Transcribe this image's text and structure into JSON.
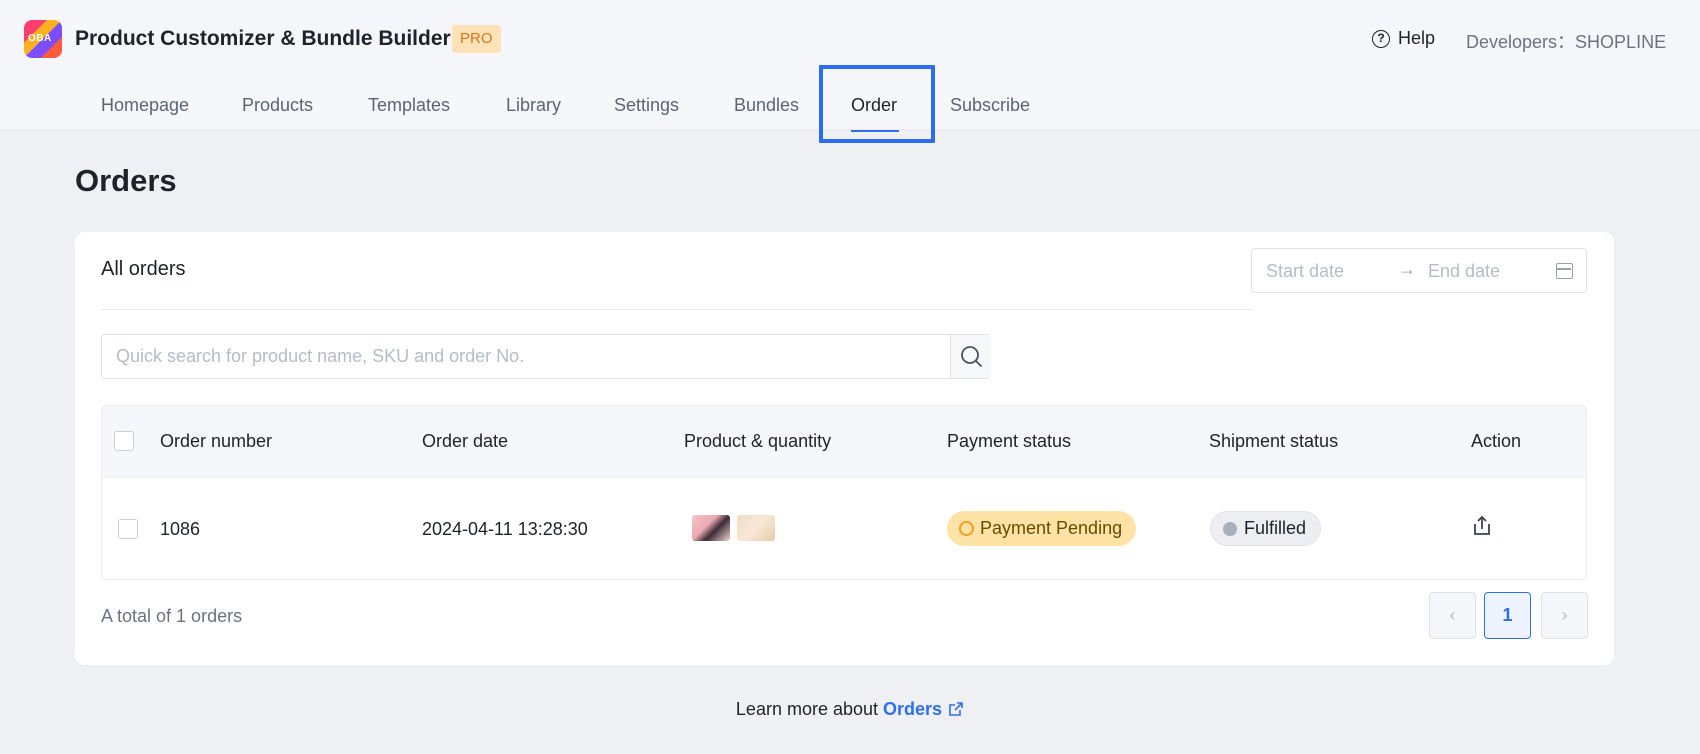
{
  "app": {
    "logo_text": "OBA",
    "title": "Product Customizer & Bundle Builder",
    "plan_badge": "PRO",
    "help_label": "Help",
    "developers_label": "Developers：SHOPLINE"
  },
  "nav": {
    "items": [
      {
        "label": "Homepage",
        "active": false
      },
      {
        "label": "Products",
        "active": false
      },
      {
        "label": "Templates",
        "active": false
      },
      {
        "label": "Library",
        "active": false
      },
      {
        "label": "Settings",
        "active": false
      },
      {
        "label": "Bundles",
        "active": false
      },
      {
        "label": "Order",
        "active": true
      },
      {
        "label": "Subscribe",
        "active": false
      }
    ]
  },
  "page": {
    "title": "Orders"
  },
  "orders_card": {
    "title": "All orders",
    "date_range": {
      "start_placeholder": "Start date",
      "arrow": "→",
      "end_placeholder": "End date"
    },
    "search": {
      "placeholder": "Quick search for product name, SKU and order No.",
      "value": ""
    },
    "table": {
      "columns": [
        "Order number",
        "Order date",
        "Product & quantity",
        "Payment status",
        "Shipment status",
        "Action"
      ],
      "rows": [
        {
          "order_number": "1086",
          "order_date": "2024-04-11 13:28:30",
          "product_thumbnails": 2,
          "payment_status": "Payment Pending",
          "shipment_status": "Fulfilled",
          "action_icon": "export-icon"
        }
      ]
    },
    "total_text": "A total of 1 orders",
    "pagination": {
      "prev": "‹",
      "current_page": "1",
      "next": "›"
    }
  },
  "footer": {
    "learn_prefix": "Learn more about",
    "learn_link": "Orders"
  },
  "colors": {
    "accent": "#2f6fed",
    "highlight_border": "#2b6cf0",
    "pro_badge_bg": "#ffe2b8",
    "pending_bg": "#ffe2a6",
    "fulfilled_bg": "#eceef2"
  }
}
